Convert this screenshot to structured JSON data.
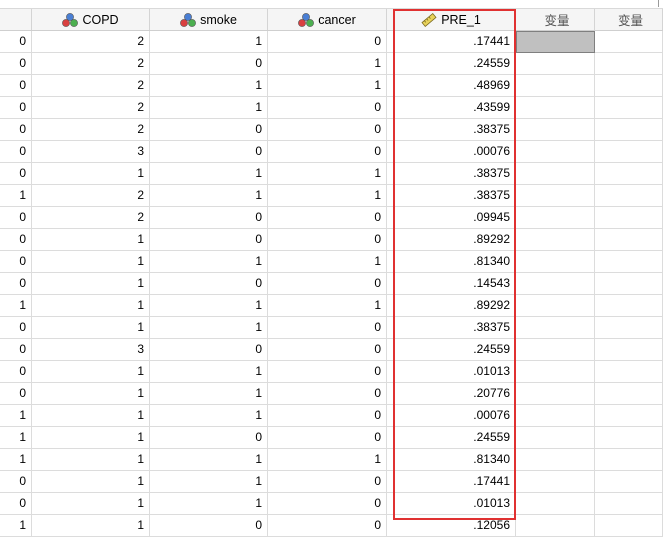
{
  "colors": {
    "highlight": "#e03131",
    "selected_cell": "#c0c0c0"
  },
  "columns": [
    {
      "label": "",
      "icon": ""
    },
    {
      "label": "COPD",
      "icon": "nominal-measure-icon"
    },
    {
      "label": "smoke",
      "icon": "nominal-measure-icon"
    },
    {
      "label": "cancer",
      "icon": "nominal-measure-icon"
    },
    {
      "label": "PRE_1",
      "icon": "scale-measure-ruler-icon"
    },
    {
      "label": "变量",
      "icon": ""
    },
    {
      "label": "变量",
      "icon": ""
    }
  ],
  "rows": [
    [
      "0",
      "2",
      "1",
      "0",
      ".17441"
    ],
    [
      "0",
      "2",
      "0",
      "1",
      ".24559"
    ],
    [
      "0",
      "2",
      "1",
      "1",
      ".48969"
    ],
    [
      "0",
      "2",
      "1",
      "0",
      ".43599"
    ],
    [
      "0",
      "2",
      "0",
      "0",
      ".38375"
    ],
    [
      "0",
      "3",
      "0",
      "0",
      ".00076"
    ],
    [
      "0",
      "1",
      "1",
      "1",
      ".38375"
    ],
    [
      "1",
      "2",
      "1",
      "1",
      ".38375"
    ],
    [
      "0",
      "2",
      "0",
      "0",
      ".09945"
    ],
    [
      "0",
      "1",
      "0",
      "0",
      ".89292"
    ],
    [
      "0",
      "1",
      "1",
      "1",
      ".81340"
    ],
    [
      "0",
      "1",
      "0",
      "0",
      ".14543"
    ],
    [
      "1",
      "1",
      "1",
      "1",
      ".89292"
    ],
    [
      "0",
      "1",
      "1",
      "0",
      ".38375"
    ],
    [
      "0",
      "3",
      "0",
      "0",
      ".24559"
    ],
    [
      "0",
      "1",
      "1",
      "0",
      ".01013"
    ],
    [
      "0",
      "1",
      "1",
      "0",
      ".20776"
    ],
    [
      "1",
      "1",
      "1",
      "0",
      ".00076"
    ],
    [
      "1",
      "1",
      "0",
      "0",
      ".24559"
    ],
    [
      "1",
      "1",
      "1",
      "1",
      ".81340"
    ],
    [
      "0",
      "1",
      "1",
      "0",
      ".17441"
    ],
    [
      "0",
      "1",
      "1",
      "0",
      ".01013"
    ],
    [
      "1",
      "1",
      "0",
      "0",
      ".12056"
    ]
  ]
}
